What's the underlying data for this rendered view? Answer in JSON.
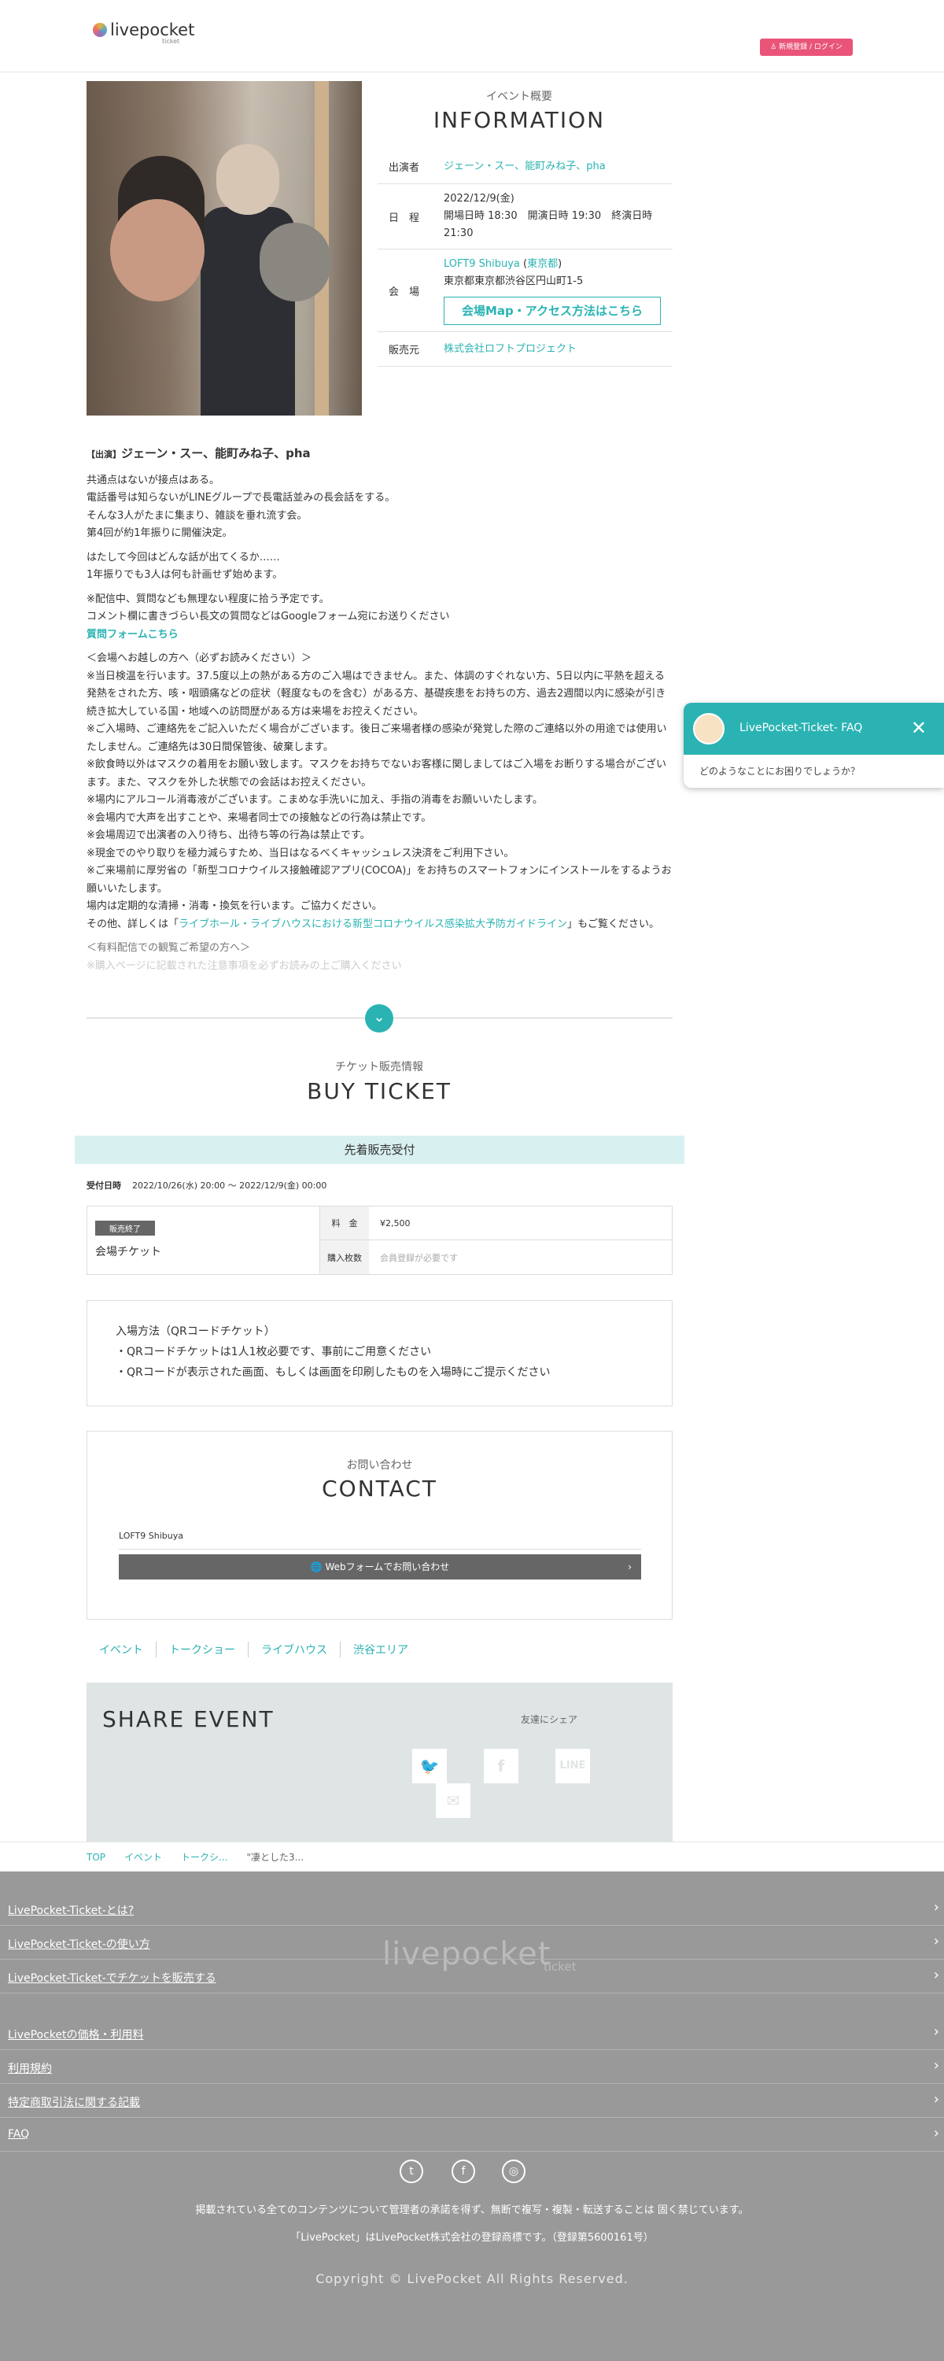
{
  "header": {
    "brand": "livepocket",
    "brand_sub": "ticket",
    "login": "新規登録 / ログイン"
  },
  "info": {
    "subtitle": "イベント概要",
    "title": "INFORMATION",
    "performer_label": "出演者",
    "performers": "ジェーン・スー、能町みね子、pha",
    "date_label": "日　程",
    "date": "2022/12/9(金)",
    "times": "開場日時 18:30　開演日時 19:30　終演日時 21:30",
    "venue_label": "会　場",
    "venue_name": "LOFT9 Shibuya",
    "venue_area": "東京都",
    "venue_address": "東京都東京都渋谷区円山町1-5",
    "access_button": "会場Map・アクセス方法はこちら",
    "seller_label": "販売元",
    "seller": "株式会社ロフトプロジェクト"
  },
  "description": {
    "cast_prefix": "【出演】",
    "cast": "ジェーン・スー、能町みね子、pha",
    "p1": "共通点はないが接点はある。\n電話番号は知らないがLINEグループで長電話並みの長会話をする。\nそんな3人がたまに集まり、雑談を垂れ流す会。\n第4回が約1年振りに開催決定。",
    "p2": "はたして今回はどんな話が出てくるか……\n1年振りでも3人は何も計画せず始めます。",
    "p3": "※配信中、質問なども無理ない程度に拾う予定です。\nコメント欄に書きづらい長文の質問などはGoogleフォーム宛にお送りください",
    "form_link": "質問フォームこちら",
    "p4": "＜会場へお越しの方へ（必ずお読みください）＞\n※当日検温を行います。37.5度以上の熱がある方のご入場はできません。また、体調のすぐれない方、5日以内に平熱を超える発熱をされた方、咳・咽頭痛などの症状（軽度なものを含む）がある方、基礎疾患をお持ちの方、過去2週間以内に感染が引き続き拡大している国・地域への訪問歴がある方は来場をお控えください。\n※ご入場時、ご連絡先をご記入いただく場合がございます。後日ご来場者様の感染が発覚した際のご連絡以外の用途では使用いたしません。ご連絡先は30日間保管後、破棄します。\n※飲食時以外はマスクの着用をお願い致します。マスクをお持ちでないお客様に関しましてはご入場をお断りする場合がございます。また、マスクを外した状態での会話はお控えください。\n※場内にアルコール消毒液がございます。こまめな手洗いに加え、手指の消毒をお願いいたします。\n※会場内で大声を出すことや、来場者同士での接触などの行為は禁止です。\n※会場周辺で出演者の入り待ち、出待ち等の行為は禁止です。\n※現金でのやり取りを極力減らすため、当日はなるべくキャッシュレス決済をご利用下さい。\n※ご来場前に厚労省の「新型コロナウイルス接触確認アプリ(COCOA)」をお持ちのスマートフォンにインストールをするようお願いいたします。\n場内は定期的な清掃・消毒・換気を行います。ご協力ください。",
    "p5_pre": "その他、詳しくは「",
    "p5_link": "ライブホール・ライブハウスにおける新型コロナウイルス感染拡大予防ガイドライン",
    "p5_post": "」もご覧ください。",
    "p6": "＜有料配信での観覧ご希望の方へ＞",
    "p7": "※購入ページに記載された注意事項を必ずお読みの上ご購入ください"
  },
  "ticket": {
    "subtitle": "チケット販売情報",
    "title": "BUY TICKET",
    "band": "先着販売受付",
    "period_label": "受付日時",
    "period": "2022/10/26(水) 20:00 〜 2022/12/9(金) 00:00",
    "badge": "販売終了",
    "name": "会場チケット",
    "price_label": "料　金",
    "price": "¥2,500",
    "qty_label": "購入枚数",
    "qty_note": "会員登録が必要です"
  },
  "entry": {
    "title": "入場方法（QRコードチケット）",
    "line1": "・QRコードチケットは1人1枚必要です、事前にご用意ください",
    "line2": "・QRコードが表示された画面、もしくは画面を印刷したものを入場時にご提示ください"
  },
  "contact": {
    "subtitle": "お問い合わせ",
    "title": "CONTACT",
    "venue": "LOFT9 Shibuya",
    "button": "Webフォームでお問い合わせ"
  },
  "tags": [
    "イベント",
    "トークショー",
    "ライブハウス",
    "渋谷エリア"
  ],
  "share": {
    "title": "SHARE EVENT",
    "friends": "友達にシェア",
    "line": "LINE"
  },
  "breadcrumb": [
    "TOP",
    "イベント",
    "トークシ...",
    "\"凄とした3..."
  ],
  "faq": {
    "title": "LivePocket-Ticket- FAQ",
    "message": "どのようなことにお困りでしょうか？"
  },
  "footer": {
    "watermark": "livepocket",
    "watermark_sub": "ticket",
    "links": [
      "LivePocket-Ticket-とは?",
      "LivePocket-Ticket-の使い方",
      "LivePocket-Ticket-でチケットを販売する",
      "LivePocketの価格・利用料",
      "利用規約",
      "特定商取引法に関する記載",
      "FAQ"
    ],
    "notice": "掲載されている全てのコンテンツについて管理者の承諾を得ず、無断で複写・複製・転送することは 固く禁じています。",
    "trademark": "「LivePocket」はLivePocket株式会社の登録商標です。（登録第5600161号）",
    "copyright": "Copyright © LivePocket All Rights Reserved."
  }
}
